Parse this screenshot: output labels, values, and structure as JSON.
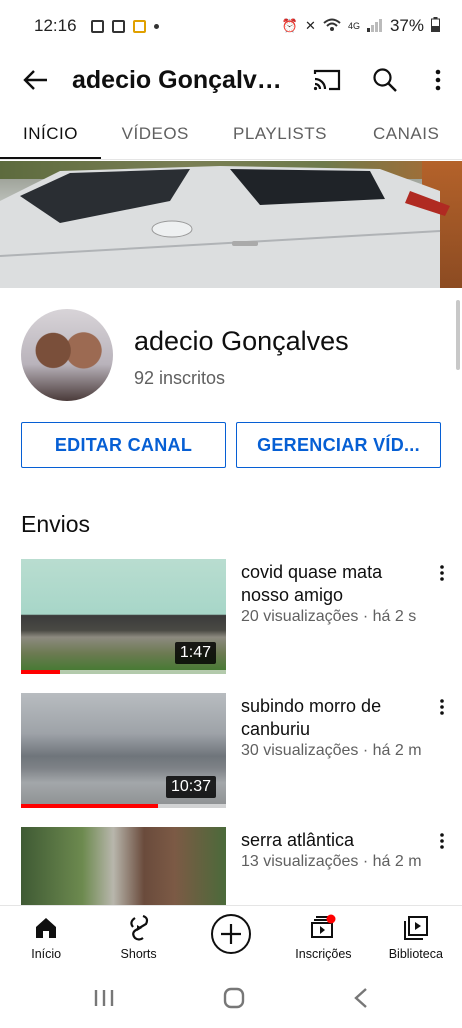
{
  "status_bar": {
    "time": "12:16",
    "battery": "37%",
    "network": "4G"
  },
  "header": {
    "title": "adecio Gonçalves",
    "back_icon": "arrow-left-icon",
    "cast_icon": "cast-icon",
    "search_icon": "search-icon",
    "more_icon": "more-vert-icon"
  },
  "tabs": [
    {
      "label": "INÍCIO",
      "active": true
    },
    {
      "label": "VÍDEOS",
      "active": false
    },
    {
      "label": "PLAYLISTS",
      "active": false
    },
    {
      "label": "CANAIS",
      "active": false
    }
  ],
  "channel": {
    "name": "adecio Gonçalves",
    "subscribers": "92 inscritos",
    "edit_button": "EDITAR CANAL",
    "manage_button": "GERENCIAR VÍD..."
  },
  "section": {
    "title": "Envios"
  },
  "videos": [
    {
      "title": "covid quase mata nosso amigo",
      "meta": "20 visualizações · há 2 s",
      "duration": "1:47",
      "progress": 0.19
    },
    {
      "title": "subindo morro de canburiu",
      "meta": "30 visualizações · há 2 m",
      "duration": "10:37",
      "progress": 0.67
    },
    {
      "title": "serra atlântica",
      "meta": "13 visualizações · há 2 m",
      "duration": "",
      "progress": 0
    }
  ],
  "bottom_nav": [
    {
      "label": "Início",
      "icon": "home-icon"
    },
    {
      "label": "Shorts",
      "icon": "shorts-icon"
    },
    {
      "label": "",
      "icon": "create-icon"
    },
    {
      "label": "Inscrições",
      "icon": "subscriptions-icon"
    },
    {
      "label": "Biblioteca",
      "icon": "library-icon"
    }
  ],
  "colors": {
    "accent": "#065fd4",
    "progress": "#ff0000",
    "notification": "#ff0000"
  }
}
